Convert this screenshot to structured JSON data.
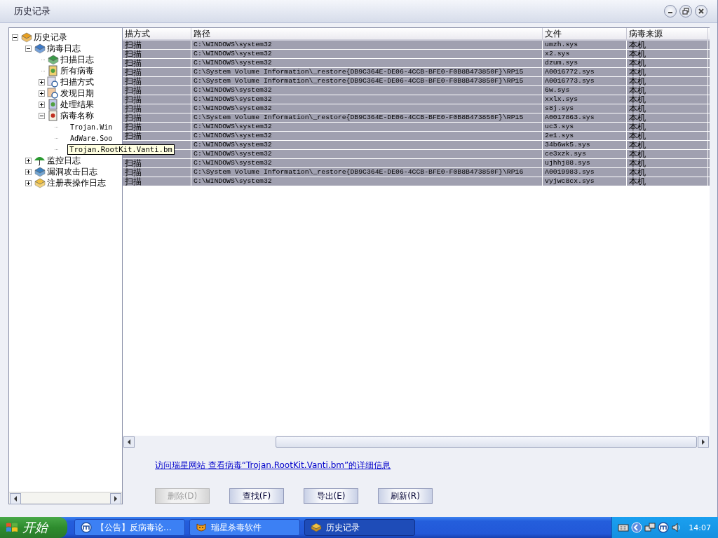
{
  "window": {
    "title": "历史记录"
  },
  "tree": [
    {
      "label": "历史记录",
      "kind": "books",
      "expanded": true,
      "children": [
        {
          "label": "病毒日志",
          "kind": "bluebook",
          "expanded": true,
          "children": [
            {
              "label": "扫描日志",
              "kind": "greenbook"
            },
            {
              "label": "所有病毒",
              "kind": "folder"
            },
            {
              "label": "扫描方式",
              "kind": "search",
              "expanded": false
            },
            {
              "label": "发现日期",
              "kind": "clock",
              "expanded": false
            },
            {
              "label": "处理结果",
              "kind": "result",
              "expanded": false
            },
            {
              "label": "病毒名称",
              "kind": "virus",
              "expanded": true,
              "children": [
                {
                  "label": "Trojan.Win",
                  "kind": "text"
                },
                {
                  "label": "AdWare.Soo",
                  "kind": "text"
                },
                {
                  "label": "Trojan.RootKit.Vanti.bm",
                  "kind": "text",
                  "hovered": true
                }
              ]
            }
          ]
        },
        {
          "label": "监控日志",
          "kind": "umbrella",
          "expanded": false
        },
        {
          "label": "漏洞攻击日志",
          "kind": "shield",
          "expanded": false
        },
        {
          "label": "注册表操作日志",
          "kind": "registry",
          "expanded": false
        }
      ]
    }
  ],
  "table": {
    "columns": [
      "描方式",
      "路径",
      "文件",
      "病毒来源"
    ],
    "rows": [
      {
        "cells": [
          "扫描",
          "C:\\WINDOWS\\system32",
          "umzh.sys",
          "本机"
        ],
        "selected": true
      },
      {
        "cells": [
          "扫描",
          "C:\\WINDOWS\\system32",
          "x2.sys",
          "本机"
        ],
        "selected": true
      },
      {
        "cells": [
          "扫描",
          "C:\\WINDOWS\\system32",
          "dzum.sys",
          "本机"
        ],
        "selected": true
      },
      {
        "cells": [
          "扫描",
          "C:\\System Volume Information\\_restore{DB9C364E-DE06-4CCB-BFE0-F0B8B473850F}\\RP15",
          "A0016772.sys",
          "本机"
        ],
        "selected": true
      },
      {
        "cells": [
          "扫描",
          "C:\\System Volume Information\\_restore{DB9C364E-DE06-4CCB-BFE0-F0B8B473850F}\\RP15",
          "A0016773.sys",
          "本机"
        ],
        "selected": true
      },
      {
        "cells": [
          "扫描",
          "C:\\WINDOWS\\system32",
          "6w.sys",
          "本机"
        ],
        "selected": true
      },
      {
        "cells": [
          "扫描",
          "C:\\WINDOWS\\system32",
          "xxlx.sys",
          "本机"
        ],
        "selected": true
      },
      {
        "cells": [
          "扫描",
          "C:\\WINDOWS\\system32",
          "s8j.sys",
          "本机"
        ],
        "selected": true
      },
      {
        "cells": [
          "扫描",
          "C:\\System Volume Information\\_restore{DB9C364E-DE06-4CCB-BFE0-F0B8B473850F}\\RP15",
          "A0017863.sys",
          "本机"
        ],
        "selected": true
      },
      {
        "cells": [
          "扫描",
          "C:\\WINDOWS\\system32",
          "uc3.sys",
          "本机"
        ],
        "selected": true
      },
      {
        "cells": [
          "扫描",
          "C:\\WINDOWS\\system32",
          "2e1.sys",
          "本机"
        ],
        "selected": true
      },
      {
        "cells": [
          null,
          "C:\\WINDOWS\\system32",
          "34b6wk5.sys",
          "本机"
        ],
        "selected": true
      },
      {
        "cells": [
          null,
          "C:\\WINDOWS\\system32",
          "ce3xzk.sys",
          "本机"
        ],
        "selected": true
      },
      {
        "cells": [
          "扫描",
          "C:\\WINDOWS\\system32",
          "ujhhj88.sys",
          "本机"
        ],
        "selected": true
      },
      {
        "cells": [
          "扫描",
          "C:\\System Volume Information\\_restore{DB9C364E-DE06-4CCB-BFE0-F0B8B473850F}\\RP16",
          "A0019983.sys",
          "本机"
        ],
        "selected": true
      },
      {
        "cells": [
          "扫描",
          "C:\\WINDOWS\\system32",
          "vyjwc8cx.sys",
          "本机"
        ],
        "selected": true
      }
    ]
  },
  "link": "访问瑞星网站 查看病毒“Trojan.RootKit.Vanti.bm”的详细信息",
  "buttons": [
    {
      "label": "删除(D)",
      "disabled": true
    },
    {
      "label": "查找(F)",
      "disabled": false
    },
    {
      "label": "导出(E)",
      "disabled": false
    },
    {
      "label": "刷新(R)",
      "disabled": false
    }
  ],
  "taskbar": {
    "start": "开始",
    "tasks": [
      {
        "label": "【公告】反病毒论...",
        "kind": "browser",
        "selected": false
      },
      {
        "label": "瑞星杀毒软件",
        "kind": "tiger",
        "selected": false
      },
      {
        "label": "历史记录",
        "kind": "books",
        "selected": true
      }
    ],
    "clock": "14:07"
  }
}
